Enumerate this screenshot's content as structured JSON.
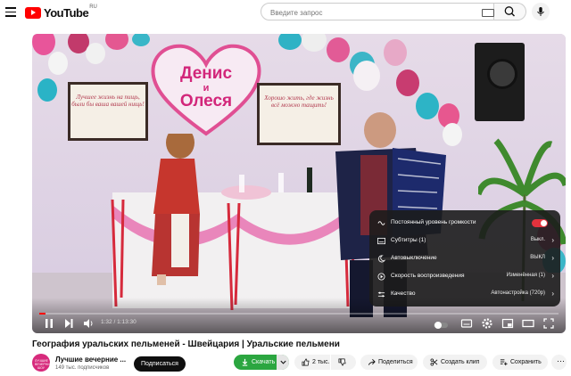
{
  "header": {
    "logo_text": "YouTube",
    "logo_region": "RU",
    "search_placeholder": "Введите запрос"
  },
  "player": {
    "scene_text": {
      "heart_name1": "Денис",
      "heart_and": "и",
      "heart_name2": "Олеся",
      "left_frame": "Лучшее жизнь на пищь, были бы ваша вашей нищь!",
      "right_frame": "Хорошо жить, где жизнь всё можно тащить!"
    },
    "progress": 0.0113,
    "time_current": "1:32",
    "time_total": "1:13:30",
    "settings_menu": {
      "items": [
        {
          "icon": "volume-stable-icon",
          "label": "Постоянный уровень громкости",
          "value": "",
          "toggle": true
        },
        {
          "icon": "subtitles-icon",
          "label": "Субтитры (1)",
          "value": "Выкл."
        },
        {
          "icon": "sleep-timer-icon",
          "label": "Автовыключение",
          "value": "ВЫКЛ"
        },
        {
          "icon": "playback-speed-icon",
          "label": "Скорость воспроизведения",
          "value": "Изменённая (1)"
        },
        {
          "icon": "quality-icon",
          "label": "Качество",
          "value": "Автонастройка (720p)"
        }
      ]
    }
  },
  "video": {
    "title": "География уральских пельменей - Швейцария | Уральские пельмени"
  },
  "channel": {
    "name": "Лучшие вечерние ...",
    "subscribers": "149 тыс. подписчиков",
    "avatar_text": "ЛУЧШИЕ ВЕЧЕРНИЕ ШОУ",
    "subscribe_label": "Подписаться"
  },
  "actions": {
    "download": "Скачать",
    "likes": "2 тыс.",
    "share": "Поделиться",
    "clip": "Создать клип",
    "save": "Сохранить"
  },
  "colors": {
    "accent": "#ff0000",
    "download_green": "#2ba640",
    "toggle_on": "#e2323d"
  }
}
